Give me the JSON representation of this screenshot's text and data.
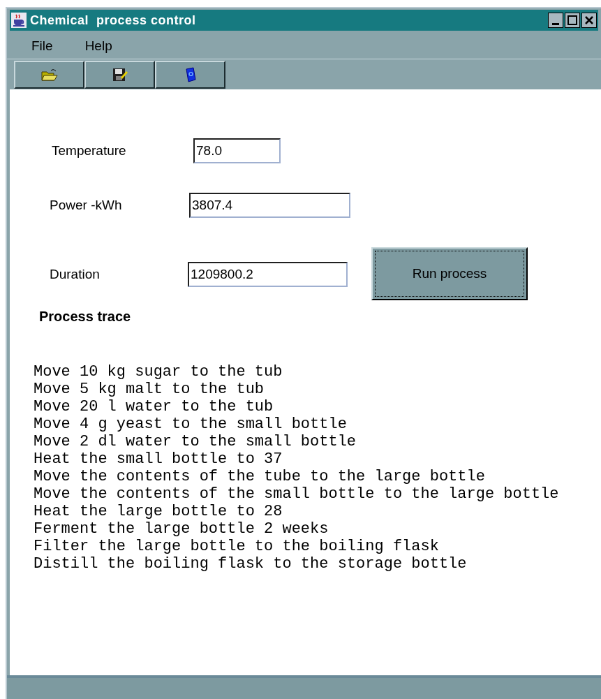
{
  "window": {
    "title": "Chemical  process control"
  },
  "menu": [
    "File",
    "Help"
  ],
  "fields": [
    {
      "label": "Temperature",
      "value": "78.0"
    },
    {
      "label": "Power -kWh",
      "value": "3807.4"
    },
    {
      "label": "Duration",
      "value": "1209800.2"
    }
  ],
  "run_button": "Run process",
  "trace": {
    "title": "Process trace",
    "lines": [
      "Move 10 kg sugar to the tub",
      "Move 5 kg malt to the tub",
      "Move 20 l water to the tub",
      "Move 4 g yeast to the small bottle",
      "Move 2 dl water to the small bottle",
      "Heat the small bottle to 37",
      "Move the contents of the tube to the large bottle",
      "Move the contents of the small bottle to the large bottle",
      "Heat the large bottle to 28",
      "Ferment the large bottle 2 weeks",
      "Filter the large bottle to the boiling flask",
      "Distill the boiling flask to the storage bottle"
    ]
  }
}
